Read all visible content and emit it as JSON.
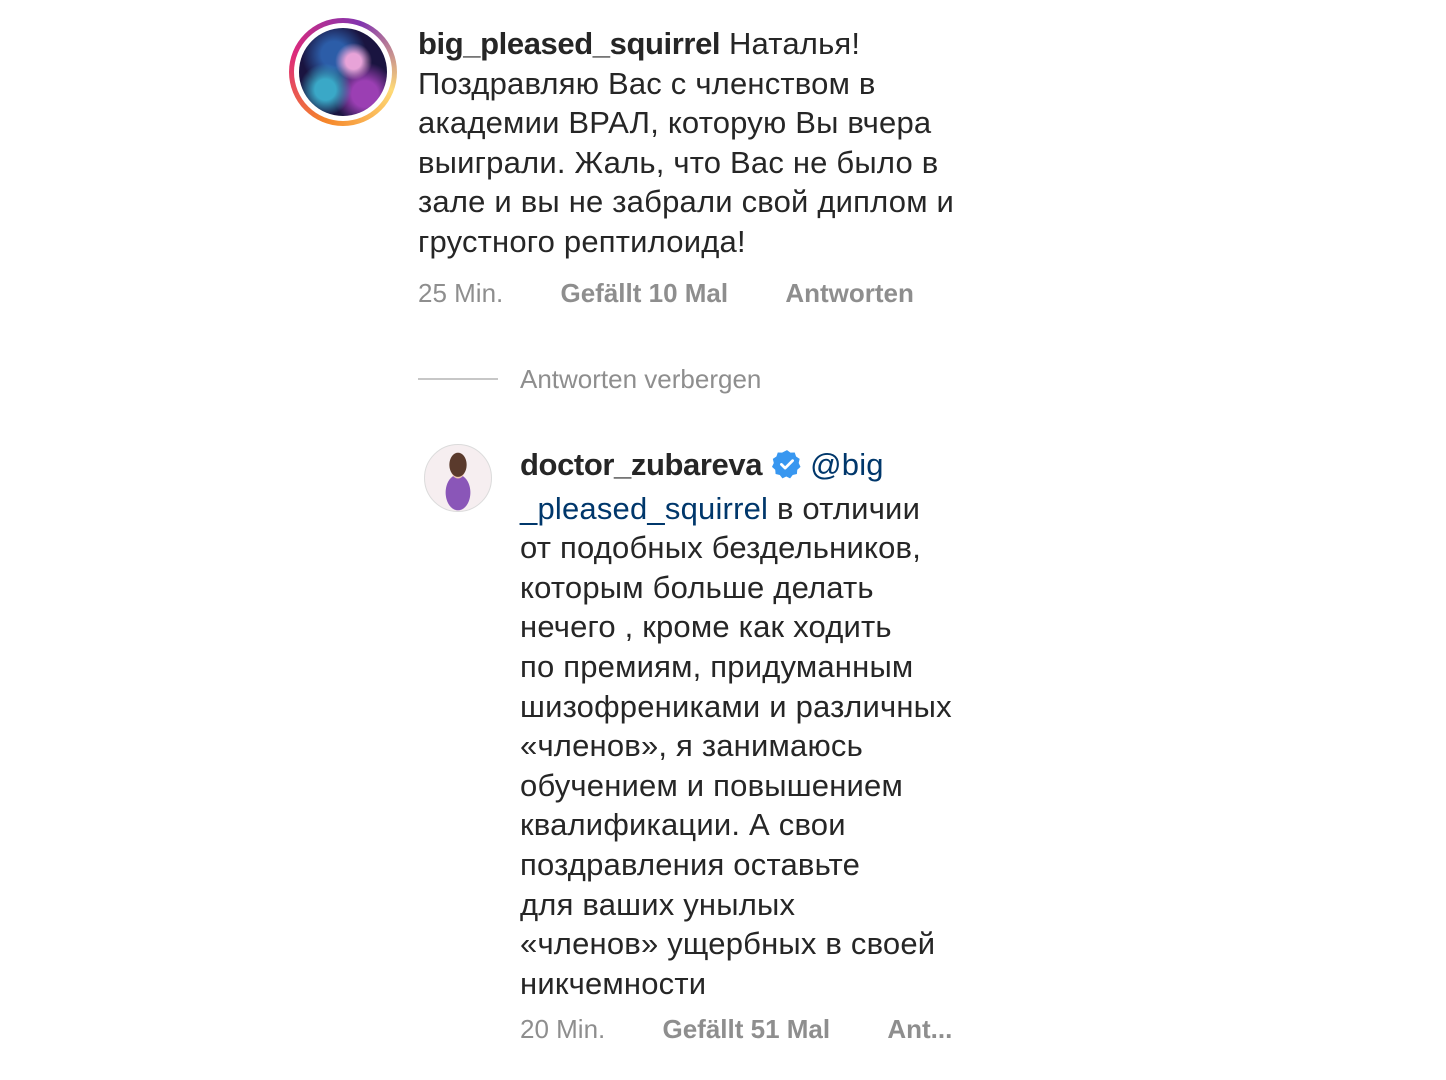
{
  "comments": [
    {
      "username": "big_pleased_squirrel",
      "avatar": "user-avatar-artwork",
      "text_lines": [
        "Наталья!",
        "Поздравляю Вас с членством в",
        "академии ВРАЛ, которую Вы вчера",
        "выиграли. Жаль, что Вас не было в",
        "зале и вы не забрали свой диплом и",
        "грустного рептилоида!"
      ],
      "time": "25 Min.",
      "likes": "Gefällt 10 Mal",
      "reply": "Antworten"
    },
    {
      "username": "doctor_zubareva",
      "verified": true,
      "verified_icon": "verified-badge-icon",
      "mention_part1": "@big",
      "mention_part2": "_pleased_squirrel",
      "first_line_rest": " в отличии",
      "text_lines": [
        "от подобных бездельников,",
        "которым больше делать",
        "нечего , кроме как ходить",
        "по премиям, придуманным",
        "шизофрениками и различных",
        "«членов», я занимаюсь",
        "обучением и повышением",
        "квалификации. А свои",
        "поздравления оставьте",
        "для ваших унылых",
        "«членов» ущербных в своей",
        "никчемности"
      ],
      "time": "20 Min.",
      "likes": "Gefällt 51 Mal",
      "reply": "Ant..."
    }
  ],
  "hide_replies_label": "Antworten verbergen",
  "colors": {
    "text": "#262626",
    "secondary": "#8e8e8e",
    "mention": "#00376b",
    "verified": "#3897f0"
  }
}
